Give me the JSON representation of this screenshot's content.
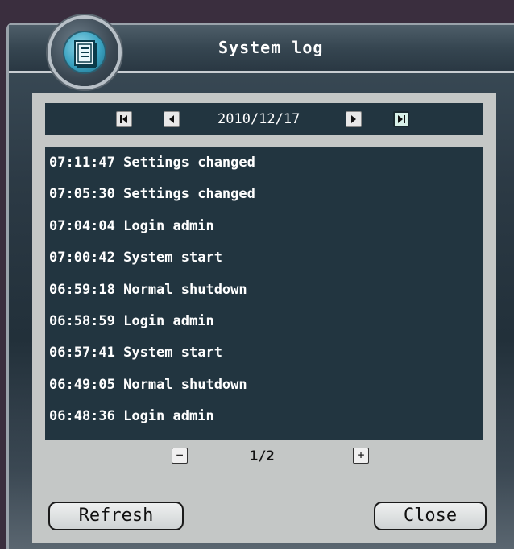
{
  "window": {
    "title": "System log"
  },
  "navigation": {
    "date": "2010/12/17",
    "first_icon": "skip-to-start-icon",
    "prev_icon": "triangle-left-icon",
    "next_icon": "triangle-right-icon",
    "last_icon": "skip-to-end-icon"
  },
  "log": {
    "entries": [
      {
        "text": "07:11:47 Settings changed"
      },
      {
        "text": "07:05:30 Settings changed"
      },
      {
        "text": "07:04:04 Login admin"
      },
      {
        "text": "07:00:42 System start"
      },
      {
        "text": "06:59:18 Normal shutdown"
      },
      {
        "text": "06:58:59 Login admin"
      },
      {
        "text": "06:57:41 System start"
      },
      {
        "text": "06:49:05 Normal shutdown"
      },
      {
        "text": "06:48:36 Login admin"
      }
    ]
  },
  "pager": {
    "minus_label": "−",
    "plus_label": "+",
    "page_info": "1/2"
  },
  "buttons": {
    "refresh_label": "Refresh",
    "close_label": "Close"
  },
  "colors": {
    "list_background": "#223540",
    "panel_background": "#c4c7c6",
    "accent_icon": "#3aa2c0"
  }
}
